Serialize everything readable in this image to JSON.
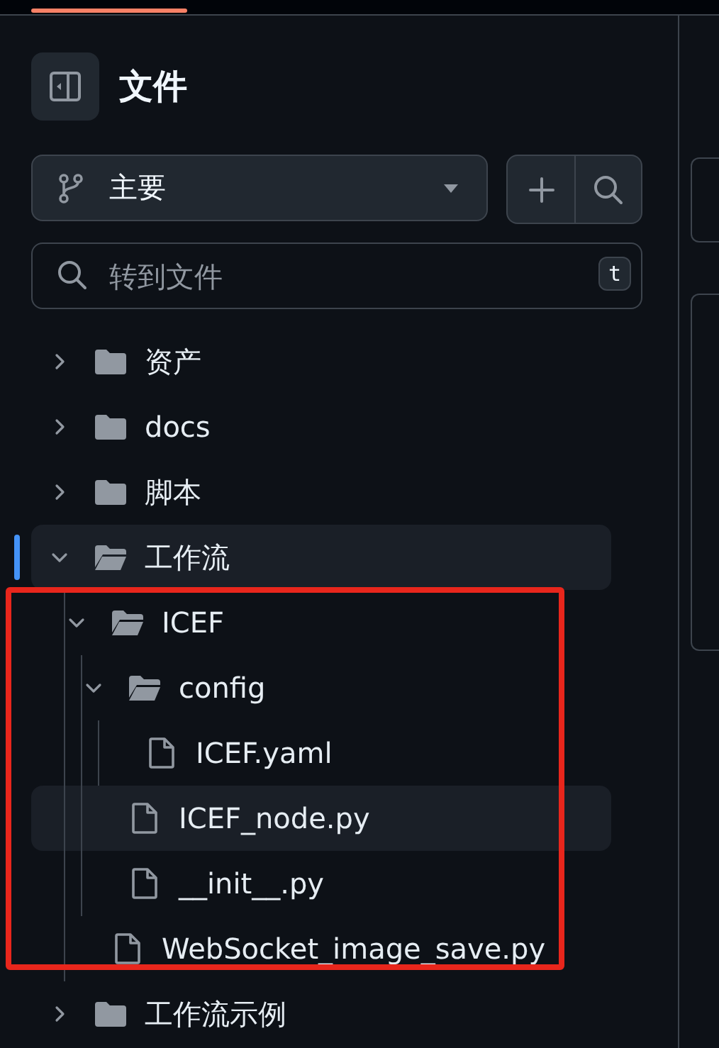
{
  "header": {
    "title": "文件"
  },
  "branch": {
    "name": "主要"
  },
  "search": {
    "placeholder": "转到文件",
    "shortcut": "t"
  },
  "tree": [
    {
      "name": "资产",
      "kind": "folder",
      "expanded": false,
      "selected": false,
      "hovered": false
    },
    {
      "name": "docs",
      "kind": "folder",
      "expanded": false,
      "selected": false,
      "hovered": false
    },
    {
      "name": "脚本",
      "kind": "folder",
      "expanded": false,
      "selected": false,
      "hovered": false
    },
    {
      "name": "工作流",
      "kind": "folder",
      "expanded": true,
      "selected": true,
      "hovered": false,
      "children": [
        {
          "name": "ICEF",
          "kind": "folder",
          "expanded": true,
          "selected": false,
          "hovered": false,
          "children": [
            {
              "name": "config",
              "kind": "folder",
              "expanded": true,
              "selected": false,
              "hovered": false,
              "children": [
                {
                  "name": "ICEF.yaml",
                  "kind": "file",
                  "selected": false,
                  "hovered": false
                }
              ]
            },
            {
              "name": "ICEF_node.py",
              "kind": "file",
              "selected": false,
              "hovered": true
            },
            {
              "name": "__init__.py",
              "kind": "file",
              "selected": false,
              "hovered": false
            }
          ]
        },
        {
          "name": "WebSocket_image_save.py",
          "kind": "file",
          "selected": false,
          "hovered": false
        }
      ]
    },
    {
      "name": "工作流示例",
      "kind": "folder",
      "expanded": false,
      "selected": false,
      "hovered": false
    }
  ]
}
